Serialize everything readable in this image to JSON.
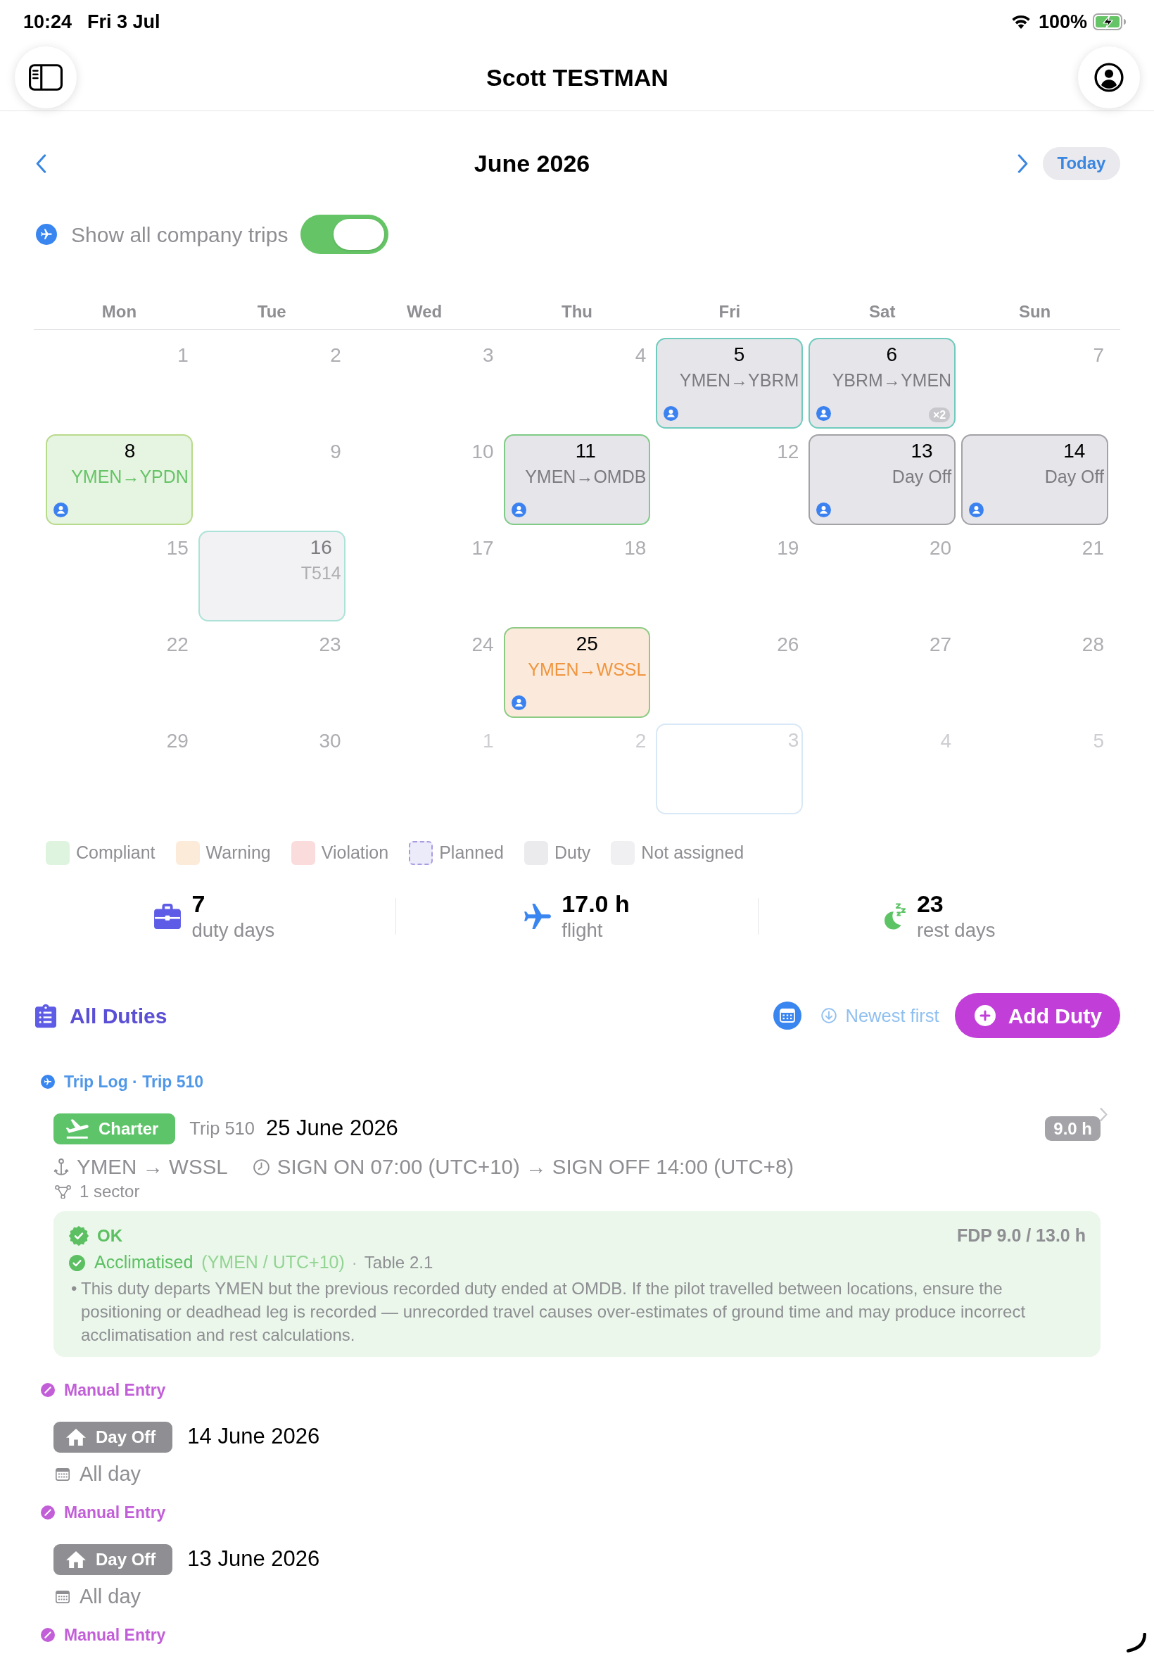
{
  "status_bar": {
    "time": "10:24",
    "date": "Fri 3 Jul",
    "battery": "100%",
    "charging": true
  },
  "header": {
    "title": "Scott TESTMAN"
  },
  "month_nav": {
    "title": "June 2026",
    "today_button": "Today"
  },
  "company_trips": {
    "label": "Show all company trips",
    "on": true
  },
  "calendar": {
    "weekdays": [
      "Mon",
      "Tue",
      "Wed",
      "Thu",
      "Fri",
      "Sat",
      "Sun"
    ],
    "weeks": [
      [
        {
          "kind": "date",
          "day": "1",
          "in_month": true
        },
        {
          "kind": "date",
          "day": "2",
          "in_month": true
        },
        {
          "kind": "date",
          "day": "3",
          "in_month": true
        },
        {
          "kind": "date",
          "day": "4",
          "in_month": true
        },
        {
          "kind": "duty",
          "day": "5",
          "in_month": true,
          "label": "YMEN→YBRM",
          "color": "#6fcbbd",
          "assigned": true
        },
        {
          "kind": "duty",
          "day": "6",
          "in_month": true,
          "label": "YBRM→YMEN",
          "color": "#6fcbbd",
          "assigned": true,
          "count": "×2"
        },
        {
          "kind": "date",
          "day": "7",
          "in_month": true
        }
      ],
      [
        {
          "kind": "compliant",
          "day": "8",
          "in_month": true,
          "label": "YMEN→YPDN",
          "color": "#b8da8b",
          "assigned": true
        },
        {
          "kind": "date",
          "day": "9",
          "in_month": true
        },
        {
          "kind": "date",
          "day": "10",
          "in_month": true
        },
        {
          "kind": "duty",
          "day": "11",
          "in_month": true,
          "label": "YMEN→OMDB",
          "color": "#80cb87",
          "assigned": true
        },
        {
          "kind": "date",
          "day": "12",
          "in_month": true
        },
        {
          "kind": "duty",
          "day": "13",
          "in_month": true,
          "label": "Day Off",
          "color": "#a2a2a7",
          "assigned": true
        },
        {
          "kind": "duty",
          "day": "14",
          "in_month": true,
          "label": "Day Off",
          "color": "#a2a2a7",
          "assigned": true
        }
      ],
      [
        {
          "kind": "date",
          "day": "15",
          "in_month": true
        },
        {
          "kind": "unassigned",
          "day": "16",
          "in_month": true,
          "label": "T514",
          "color": "#ade2d8",
          "assigned": false
        },
        {
          "kind": "date",
          "day": "17",
          "in_month": true
        },
        {
          "kind": "date",
          "day": "18",
          "in_month": true
        },
        {
          "kind": "date",
          "day": "19",
          "in_month": true
        },
        {
          "kind": "date",
          "day": "20",
          "in_month": true
        },
        {
          "kind": "date",
          "day": "21",
          "in_month": true
        }
      ],
      [
        {
          "kind": "date",
          "day": "22",
          "in_month": true
        },
        {
          "kind": "date",
          "day": "23",
          "in_month": true
        },
        {
          "kind": "date",
          "day": "24",
          "in_month": true
        },
        {
          "kind": "warning",
          "day": "25",
          "in_month": true,
          "label": "YMEN→WSSL",
          "color": "#8dcb84",
          "assigned": true
        },
        {
          "kind": "date",
          "day": "26",
          "in_month": true
        },
        {
          "kind": "date",
          "day": "27",
          "in_month": true
        },
        {
          "kind": "date",
          "day": "28",
          "in_month": true
        }
      ],
      [
        {
          "kind": "date",
          "day": "29",
          "in_month": true
        },
        {
          "kind": "date",
          "day": "30",
          "in_month": true
        },
        {
          "kind": "date",
          "day": "1",
          "in_month": false
        },
        {
          "kind": "date",
          "day": "2",
          "in_month": false
        },
        {
          "kind": "today",
          "day": "3",
          "in_month": false
        },
        {
          "kind": "date",
          "day": "4",
          "in_month": false
        },
        {
          "kind": "date",
          "day": "5",
          "in_month": false
        }
      ]
    ]
  },
  "legend": [
    {
      "label": "Compliant",
      "color": "#dff4df",
      "kind": "solid"
    },
    {
      "label": "Warning",
      "color": "#fcebd9",
      "kind": "solid"
    },
    {
      "label": "Violation",
      "color": "#fbdcdc",
      "kind": "solid"
    },
    {
      "label": "Planned",
      "color": "#ecebfa",
      "kind": "dashed"
    },
    {
      "label": "Duty",
      "color": "#ebebee",
      "kind": "solid"
    },
    {
      "label": "Not assigned",
      "color": "#f0f0f2",
      "kind": "solid"
    }
  ],
  "stats": [
    {
      "kind": "duty",
      "value": "7",
      "label": "duty days"
    },
    {
      "kind": "flight",
      "value": "17.0 h",
      "label": "flight"
    },
    {
      "kind": "rest",
      "value": "23",
      "label": "rest days"
    }
  ],
  "duties": {
    "title": "All Duties",
    "sort": "Newest first",
    "add_button": "Add Duty",
    "entries": [
      {
        "kind": "trip",
        "source": "Trip Log · Trip 510",
        "type": "Charter",
        "trip": "Trip 510",
        "date": "25 June 2026",
        "hours": "9.0 h",
        "route": "YMEN → WSSL",
        "times": "SIGN ON 07:00 (UTC+10) → SIGN OFF 14:00 (UTC+8)",
        "sectors": "1 sector",
        "check": {
          "kind": "ok",
          "status": "OK",
          "fdp": "FDP 9.0 / 13.0 h",
          "acclimatised": "Acclimatised",
          "detail": "(YMEN / UTC+10)",
          "separator": "·",
          "table": "Table 2.1",
          "notes": [
            {
              "bullet": "•",
              "text": "This duty departs YMEN but the previous recorded duty ended at OMDB. If the pilot travelled between locations, ensure the positioning or deadhead leg is recorded — unrecorded travel causes over-estimates of ground time and may produce incorrect acclimatisation and rest calculations."
            }
          ]
        }
      },
      {
        "kind": "manual",
        "source": "Manual Entry",
        "type": "Day Off",
        "date": "14 June 2026",
        "time": "All day"
      },
      {
        "kind": "manual",
        "source": "Manual Entry",
        "type": "Day Off",
        "date": "13 June 2026",
        "time": "All day"
      },
      {
        "kind": "manual",
        "source": "Manual Entry"
      }
    ]
  }
}
